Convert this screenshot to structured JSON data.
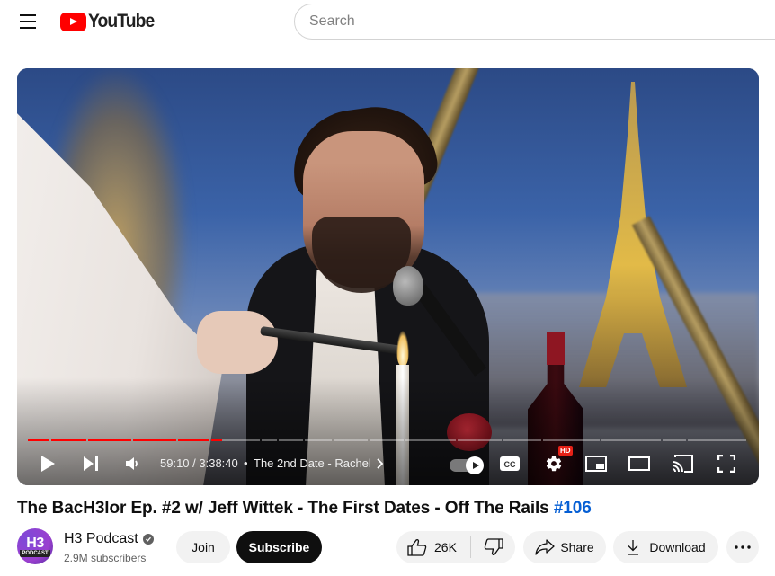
{
  "header": {
    "menu_icon": "hamburger-menu-icon",
    "logo_text": "YouTube",
    "search_placeholder": "Search"
  },
  "player": {
    "progress": {
      "current_time": "59:10",
      "duration": "3:38:40",
      "watched_fraction": 0.27,
      "chapter_count": 19
    },
    "time_display": "59:10 / 3:38:40",
    "separator": "•",
    "chapter_title": "The 2nd Date - Rachel",
    "autoplay_on": true,
    "settings_badge": "HD",
    "controls": [
      "play",
      "next",
      "volume",
      "autoplay",
      "captions",
      "settings",
      "miniplayer",
      "theater-mode",
      "cast",
      "fullscreen"
    ]
  },
  "video": {
    "title_main": "The BacH3lor Ep. #2 w/ Jeff Wittek - The First Dates - Off The Rails ",
    "title_hashtag": "#106"
  },
  "channel": {
    "name": "H3 Podcast",
    "verified": true,
    "subscribers": "2.9M subscribers",
    "avatar_text_big": "H3",
    "avatar_text_small": "PODCAST",
    "join_label": "Join",
    "subscribe_label": "Subscribe"
  },
  "actions": {
    "like_count": "26K",
    "share_label": "Share",
    "download_label": "Download"
  },
  "colors": {
    "brand_red": "#ff0000",
    "hashtag_blue": "#065fd4",
    "subscribe_bg": "#0f0f0f",
    "pill_bg": "#f2f2f2"
  }
}
